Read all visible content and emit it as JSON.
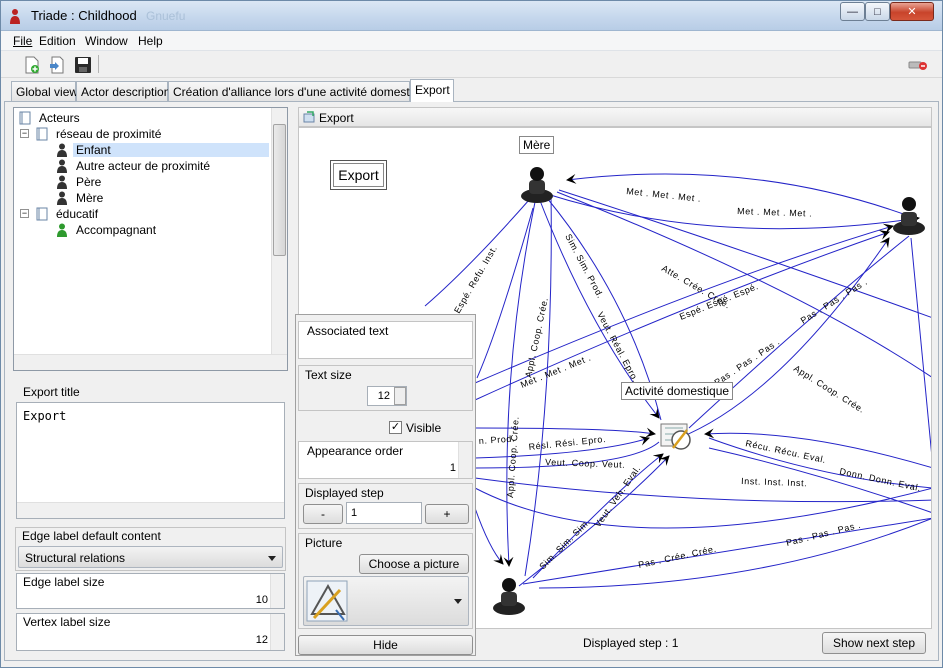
{
  "window": {
    "title": "Triade : Childhood",
    "ghost_text": "Gnuefu",
    "buttons": {
      "minimize": "—",
      "maximize": "□",
      "close": "✕"
    }
  },
  "menu": [
    "File",
    "Edition",
    "Window",
    "Help"
  ],
  "tabs": [
    "Global view",
    "Actor description",
    "Création d'alliance lors d'une activité domestique",
    "Export"
  ],
  "tree": {
    "root": "Acteurs",
    "groups": [
      {
        "label": "réseau de proximité",
        "items": [
          "Enfant",
          "Autre acteur de proximité",
          "Père",
          "Mère"
        ]
      },
      {
        "label": "éducatif",
        "items": [
          "Accompagnant"
        ]
      }
    ]
  },
  "export_title": {
    "label": "Export title",
    "value": "Export"
  },
  "edge_label_default": {
    "label": "Edge label default content",
    "value": "Structural relations"
  },
  "edge_label_size": {
    "label": "Edge label size",
    "value": "10"
  },
  "vertex_label_size": {
    "label": "Vertex label size",
    "value": "12"
  },
  "overlay": {
    "associated_text": "Associated text",
    "text_size_label": "Text size",
    "text_size": "12",
    "visible_label": "Visible",
    "appearance_order_label": "Appearance order",
    "appearance_order": "1",
    "displayed_step_label": "Displayed step",
    "minus": "-",
    "plus": "+",
    "displayed_step": "1",
    "picture_label": "Picture",
    "choose_picture": "Choose a picture",
    "hide": "Hide"
  },
  "graph": {
    "header": "Export",
    "export_button": "Export",
    "vertices": {
      "mere": "Mère",
      "activite": "Activité domestique"
    },
    "edge_labels": [
      "Met . Met . Met .",
      "Met . Met . Met .",
      "Espé. Refu. Inst.",
      "Sim. Sim. Prod.",
      "Veut. Réal. Epro.",
      "Atte. Crée. Crée.",
      "Espé. Espé. Espé.",
      "Pas . Pas . Pas .",
      "Pas . Pas . Pas .",
      "Appl. Coop. Crée.",
      "Appl. Coop. Crée.",
      "Met . Met . Met .",
      "Appl. Coop. Crée.",
      "Résl. Rési. Epro.",
      "Veut. Coop. Veut.",
      "n. Prod.",
      "Sim. Sim. Sim.",
      "Veut. Veh. Eval.",
      "Récu. Récu. Eval.",
      "Donn. Donn. Eval.",
      "Inst. Inst. Inst.",
      "Pas . Crée. Crée.",
      "Pas . Pas . Pas ."
    ]
  },
  "status": {
    "displayed_step": "Displayed step : 1",
    "show_next": "Show next step"
  }
}
